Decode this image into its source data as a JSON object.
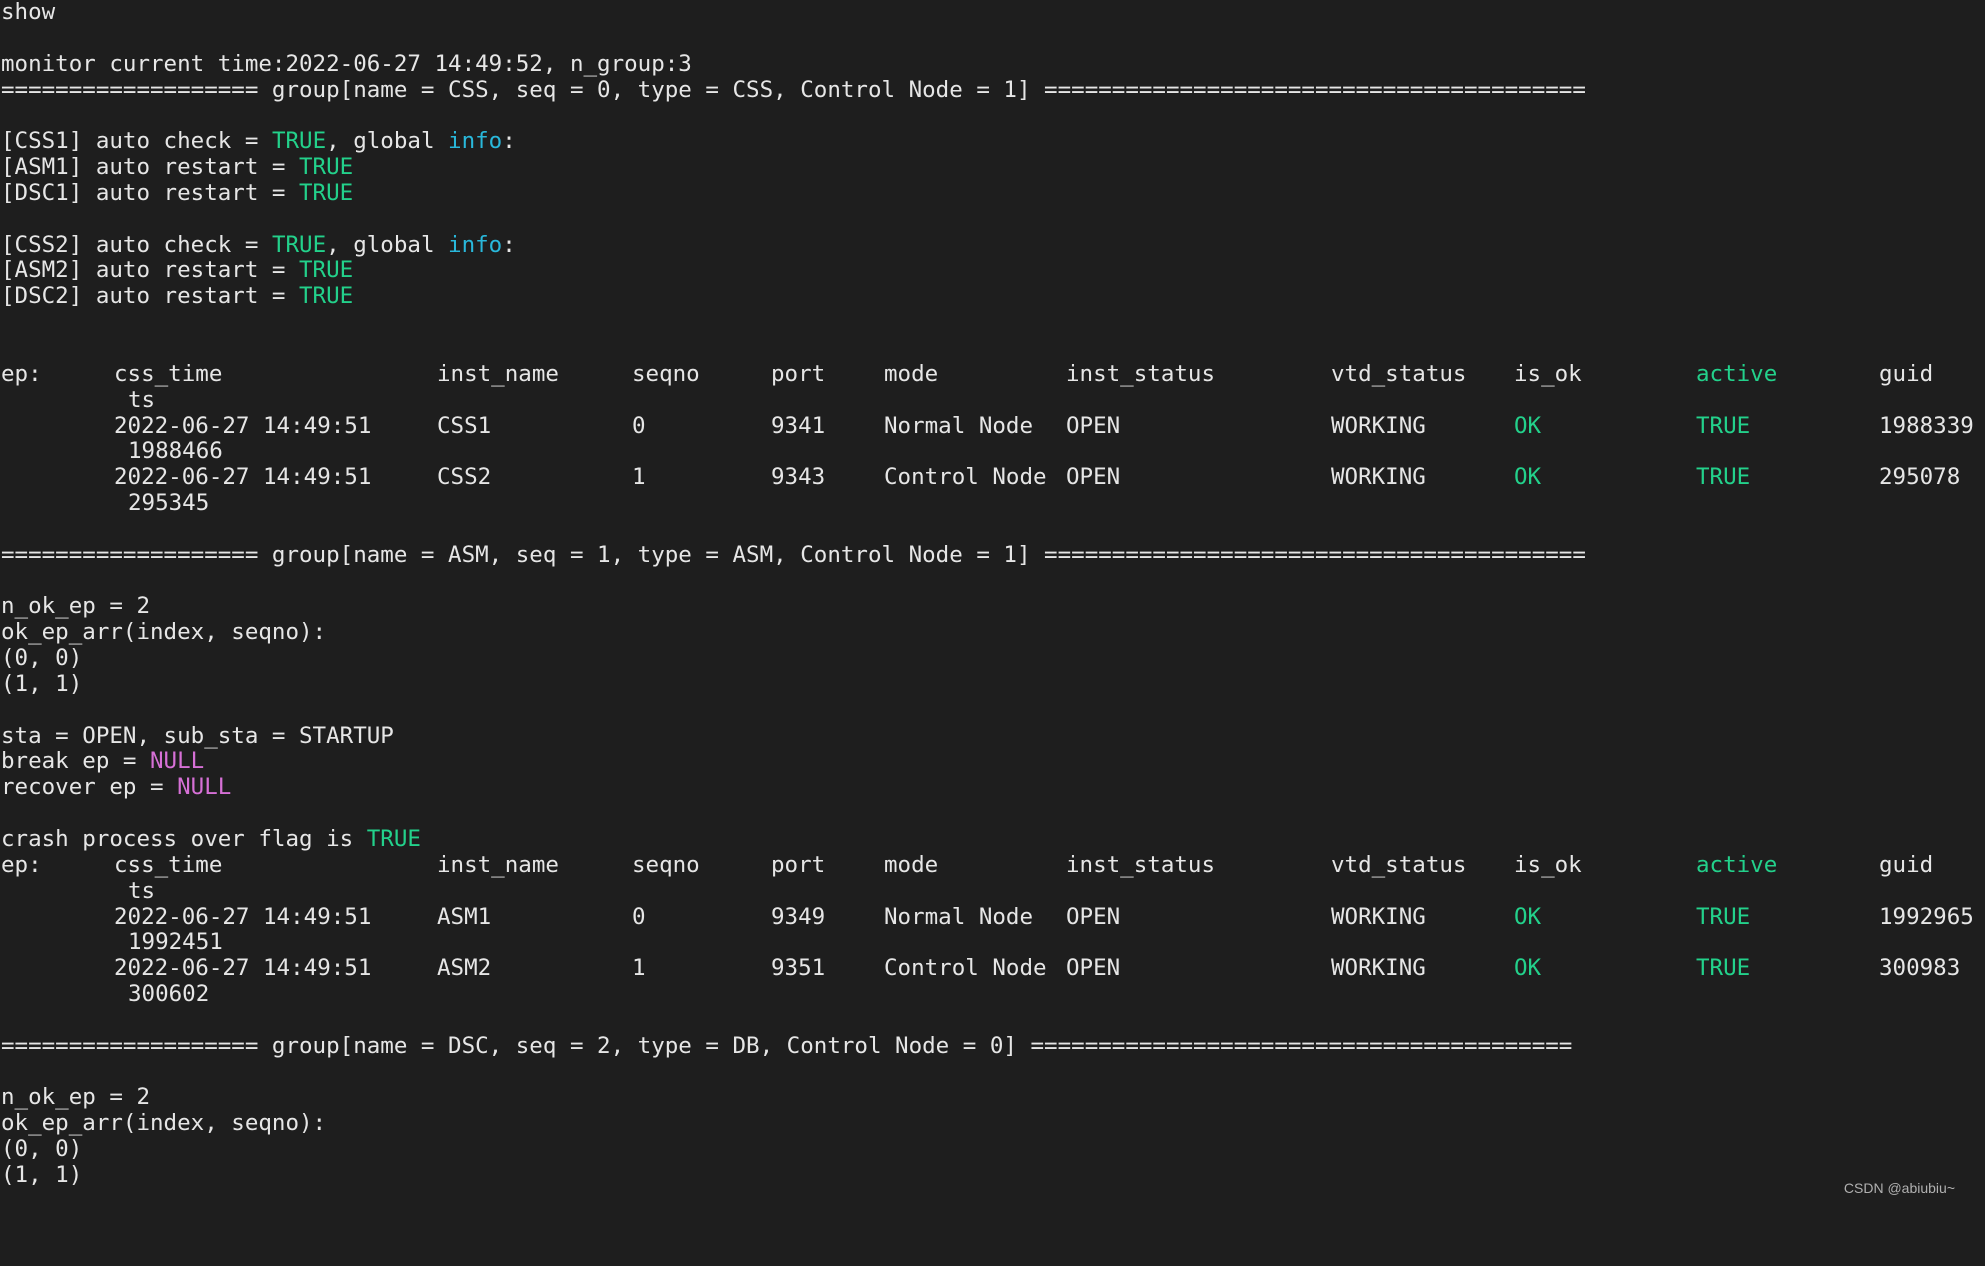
{
  "command": "show",
  "monitor_line": "monitor current time:2022-06-27 14:49:52, n_group:3",
  "colors": {
    "background": "#1e1e1e",
    "foreground": "#e6e6e6",
    "true_green": "#23d18b",
    "info_blue": "#29b8db",
    "null_magenta": "#d670d6"
  },
  "groups": [
    {
      "header": "=================== group[name = CSS, seq = 0, type = CSS, Control Node = 1] ========================================",
      "css_info": [
        {
          "lines": [
            {
              "prefix": "[CSS1] auto check = ",
              "value": "TRUE",
              "mid": ", global ",
              "info": "info",
              "suffix": ":"
            },
            {
              "prefix": "[ASM1] auto restart = ",
              "value": "TRUE"
            },
            {
              "prefix": "[DSC1] auto restart = ",
              "value": "TRUE"
            }
          ]
        },
        {
          "lines": [
            {
              "prefix": "[CSS2] auto check = ",
              "value": "TRUE",
              "mid": ", global ",
              "info": "info",
              "suffix": ":"
            },
            {
              "prefix": "[ASM2] auto restart = ",
              "value": "TRUE"
            },
            {
              "prefix": "[DSC2] auto restart = ",
              "value": "TRUE"
            }
          ]
        }
      ],
      "table": {
        "headers": {
          "ep": "ep:",
          "css_time": "css_time",
          "ts": "ts",
          "inst_name": "inst_name",
          "seqno": "seqno",
          "port": "port",
          "mode": "mode",
          "inst_status": "inst_status",
          "vtd_status": "vtd_status",
          "is_ok": "is_ok",
          "active": "active",
          "guid": "guid"
        },
        "rows": [
          {
            "css_time": "2022-06-27 14:49:51",
            "inst_name": "CSS1",
            "seqno": "0",
            "port": "9341",
            "mode": "Normal Node",
            "inst_status": "OPEN",
            "vtd_status": "WORKING",
            "is_ok": "OK",
            "active": "TRUE",
            "guid": "1988339",
            "ts": "1988466"
          },
          {
            "css_time": "2022-06-27 14:49:51",
            "inst_name": "CSS2",
            "seqno": "1",
            "port": "9343",
            "mode": "Control Node",
            "inst_status": "OPEN",
            "vtd_status": "WORKING",
            "is_ok": "OK",
            "active": "TRUE",
            "guid": "295078",
            "ts": "295345"
          }
        ]
      }
    },
    {
      "header": "=================== group[name = ASM, seq = 1, type = ASM, Control Node = 1] ========================================",
      "n_ok_ep": "n_ok_ep = 2",
      "ok_ep_arr_label": "ok_ep_arr(index, seqno):",
      "ok_ep_arr": [
        "(0, 0)",
        "(1, 1)"
      ],
      "sta_line": "sta = OPEN, sub_sta = STARTUP",
      "break_ep": {
        "label": "break ep = ",
        "value": "NULL"
      },
      "recover_ep": {
        "label": "recover ep = ",
        "value": "NULL"
      },
      "crash_flag": {
        "label": "crash process over flag is ",
        "value": "TRUE"
      },
      "table": {
        "headers": {
          "ep": "ep:",
          "css_time": "css_time",
          "ts": "ts",
          "inst_name": "inst_name",
          "seqno": "seqno",
          "port": "port",
          "mode": "mode",
          "inst_status": "inst_status",
          "vtd_status": "vtd_status",
          "is_ok": "is_ok",
          "active": "active",
          "guid": "guid"
        },
        "rows": [
          {
            "css_time": "2022-06-27 14:49:51",
            "inst_name": "ASM1",
            "seqno": "0",
            "port": "9349",
            "mode": "Normal Node",
            "inst_status": "OPEN",
            "vtd_status": "WORKING",
            "is_ok": "OK",
            "active": "TRUE",
            "guid": "1992965",
            "ts": "1992451"
          },
          {
            "css_time": "2022-06-27 14:49:51",
            "inst_name": "ASM2",
            "seqno": "1",
            "port": "9351",
            "mode": "Control Node",
            "inst_status": "OPEN",
            "vtd_status": "WORKING",
            "is_ok": "OK",
            "active": "TRUE",
            "guid": "300983",
            "ts": "300602"
          }
        ]
      }
    },
    {
      "header": "=================== group[name = DSC, seq = 2, type = DB, Control Node = 0] ========================================",
      "n_ok_ep": "n_ok_ep = 2",
      "ok_ep_arr_label": "ok_ep_arr(index, seqno):",
      "ok_ep_arr": [
        "(0, 0)",
        "(1, 1)"
      ]
    }
  ],
  "watermark": "CSDN @abiubiu~"
}
